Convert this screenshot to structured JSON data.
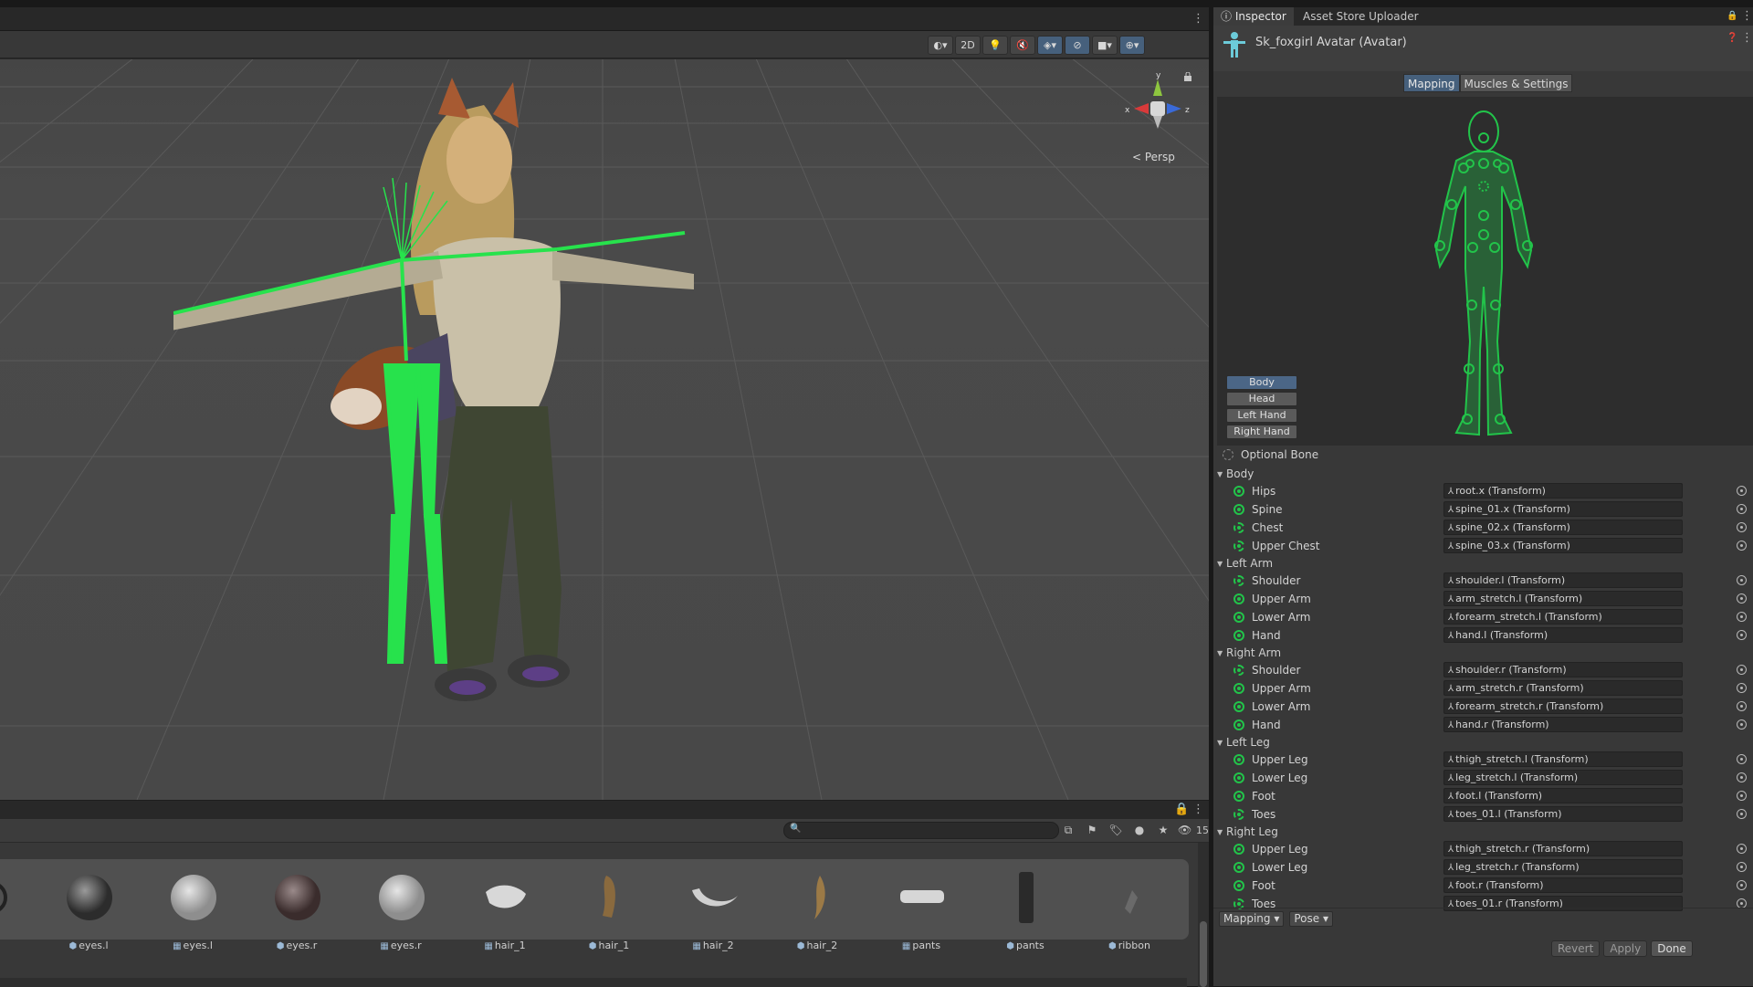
{
  "scene": {
    "toolbar": {
      "btn_2d": "2D"
    },
    "persp_label": "< Persp",
    "gizmo": {
      "y": "y",
      "x": "x",
      "z": "z"
    }
  },
  "project": {
    "search_placeholder": "",
    "visible_count": "15",
    "assets": [
      {
        "label": "eyes.l",
        "kind": "prefab"
      },
      {
        "label": "eyes.l",
        "kind": "mesh"
      },
      {
        "label": "eyes.r",
        "kind": "prefab"
      },
      {
        "label": "eyes.r",
        "kind": "mesh"
      },
      {
        "label": "hair_1",
        "kind": "mesh"
      },
      {
        "label": "hair_1",
        "kind": "prefab"
      },
      {
        "label": "hair_2",
        "kind": "mesh"
      },
      {
        "label": "hair_2",
        "kind": "prefab"
      },
      {
        "label": "pants",
        "kind": "mesh"
      },
      {
        "label": "pants",
        "kind": "prefab"
      },
      {
        "label": "ribbon",
        "kind": "prefab"
      }
    ]
  },
  "inspector": {
    "tabs": [
      "Inspector",
      "Asset Store Uploader"
    ],
    "title": "Sk_foxgirl Avatar (Avatar)",
    "mode_tabs": [
      "Mapping",
      "Muscles & Settings"
    ],
    "part_buttons": [
      "Body",
      "Head",
      "Left Hand",
      "Right Hand"
    ],
    "optional_bone": "Optional Bone",
    "groups": [
      {
        "name": "Body",
        "bones": [
          {
            "name": "Hips",
            "target": "root.x (Transform)",
            "optional": false
          },
          {
            "name": "Spine",
            "target": "spine_01.x (Transform)",
            "optional": false
          },
          {
            "name": "Chest",
            "target": "spine_02.x (Transform)",
            "optional": true
          },
          {
            "name": "Upper Chest",
            "target": "spine_03.x (Transform)",
            "optional": true
          }
        ]
      },
      {
        "name": "Left Arm",
        "bones": [
          {
            "name": "Shoulder",
            "target": "shoulder.l (Transform)",
            "optional": true
          },
          {
            "name": "Upper Arm",
            "target": "arm_stretch.l (Transform)",
            "optional": false
          },
          {
            "name": "Lower Arm",
            "target": "forearm_stretch.l (Transform)",
            "optional": false
          },
          {
            "name": "Hand",
            "target": "hand.l (Transform)",
            "optional": false
          }
        ]
      },
      {
        "name": "Right Arm",
        "bones": [
          {
            "name": "Shoulder",
            "target": "shoulder.r (Transform)",
            "optional": true
          },
          {
            "name": "Upper Arm",
            "target": "arm_stretch.r (Transform)",
            "optional": false
          },
          {
            "name": "Lower Arm",
            "target": "forearm_stretch.r (Transform)",
            "optional": false
          },
          {
            "name": "Hand",
            "target": "hand.r (Transform)",
            "optional": false
          }
        ]
      },
      {
        "name": "Left Leg",
        "bones": [
          {
            "name": "Upper Leg",
            "target": "thigh_stretch.l (Transform)",
            "optional": false
          },
          {
            "name": "Lower Leg",
            "target": "leg_stretch.l (Transform)",
            "optional": false
          },
          {
            "name": "Foot",
            "target": "foot.l (Transform)",
            "optional": false
          },
          {
            "name": "Toes",
            "target": "toes_01.l (Transform)",
            "optional": true
          }
        ]
      },
      {
        "name": "Right Leg",
        "bones": [
          {
            "name": "Upper Leg",
            "target": "thigh_stretch.r (Transform)",
            "optional": false
          },
          {
            "name": "Lower Leg",
            "target": "leg_stretch.r (Transform)",
            "optional": false
          },
          {
            "name": "Foot",
            "target": "foot.r (Transform)",
            "optional": false
          },
          {
            "name": "Toes",
            "target": "toes_01.r (Transform)",
            "optional": true
          }
        ]
      }
    ],
    "footer": {
      "mapping_dropdown": "Mapping",
      "pose_dropdown": "Pose"
    },
    "actions": {
      "revert": "Revert",
      "apply": "Apply",
      "done": "Done"
    }
  },
  "colors": {
    "bone_green": "#22c44a",
    "accent_blue": "#46607c",
    "panel": "#383838"
  }
}
